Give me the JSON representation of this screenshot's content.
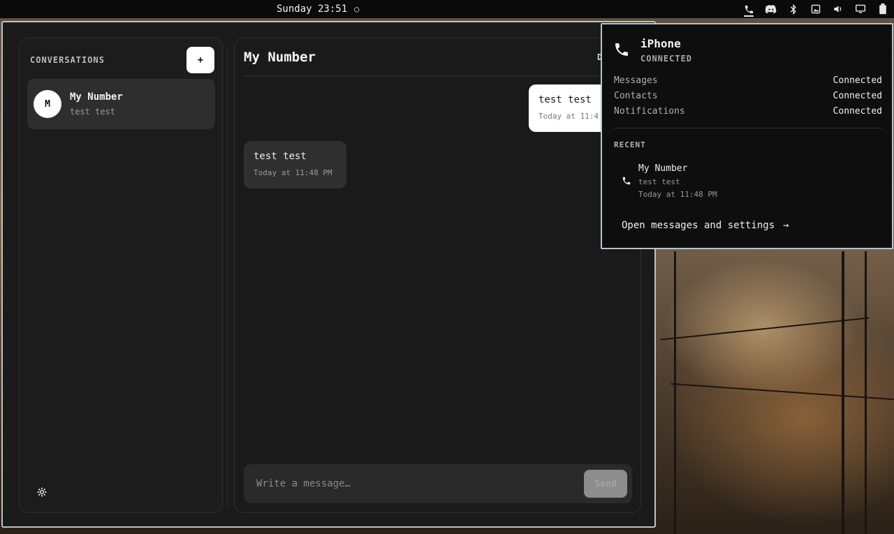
{
  "topbar": {
    "clock": "Sunday 23:51",
    "tray_icons": [
      "phone-icon",
      "discord-icon",
      "bluetooth-icon",
      "screenshot-icon",
      "volume-icon",
      "display-icon",
      "battery-icon"
    ]
  },
  "sidebar": {
    "title": "CONVERSATIONS",
    "new_button": "+",
    "conversations": [
      {
        "initial": "M",
        "name": "My Number",
        "preview": "test test"
      }
    ]
  },
  "chat": {
    "title": "My Number",
    "header_action": "D",
    "messages": [
      {
        "direction": "outgoing",
        "text": "test test",
        "time": "Today at 11:4"
      },
      {
        "direction": "incoming",
        "text": "test test",
        "time": "Today at 11:48 PM"
      }
    ],
    "composer_placeholder": "Write a message…",
    "send_label": "Send"
  },
  "popup": {
    "device": "iPhone",
    "status": "CONNECTED",
    "services": [
      {
        "name": "Messages",
        "state": "Connected"
      },
      {
        "name": "Contacts",
        "state": "Connected"
      },
      {
        "name": "Notifications",
        "state": "Connected"
      }
    ],
    "recent_heading": "RECENT",
    "recent": [
      {
        "name": "My Number",
        "text": "test test",
        "time": "Today at 11:48 PM"
      }
    ],
    "open_link": "Open messages and settings",
    "open_link_arrow": "→"
  },
  "colors": {
    "window_border": "#b9c4c9",
    "panel_bg": "#1b1b1b",
    "accent_white": "#ffffff"
  }
}
